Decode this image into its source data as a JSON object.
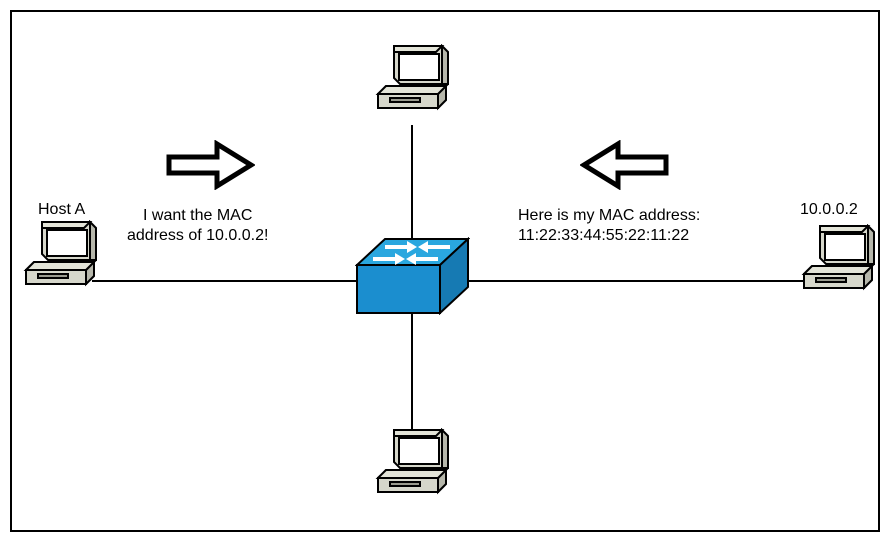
{
  "diagram": {
    "hosts": {
      "left": {
        "label": "Host A"
      },
      "right": {
        "label": "10.0.0.2"
      }
    },
    "messages": {
      "request": "I want the MAC\naddress of 10.0.0.2!",
      "reply": "Here is my MAC address:\n11:22:33:44:55:22:11:22"
    },
    "devices": {
      "switch": {
        "name": "switch"
      },
      "pc_top": {
        "name": "pc"
      },
      "pc_bottom": {
        "name": "pc"
      },
      "pc_left": {
        "name": "Host A"
      },
      "pc_right": {
        "name": "10.0.0.2"
      }
    },
    "arrows": {
      "left_to_center": "right",
      "right_to_center": "left"
    }
  }
}
